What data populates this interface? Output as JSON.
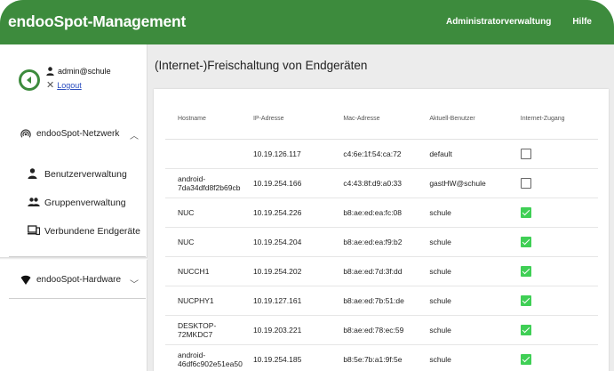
{
  "app": {
    "title": "endooSpot-Management",
    "nav": [
      "Administratorverwaltung",
      "Hilfe"
    ]
  },
  "user": {
    "name": "admin@schule",
    "logout": "Logout"
  },
  "sidebar": {
    "network_section": "endooSpot-Netzwerk",
    "items": [
      {
        "label": "Benutzerverwaltung",
        "icon": "person-icon"
      },
      {
        "label": "Gruppenverwaltung",
        "icon": "people-icon"
      },
      {
        "label": "Verbundene Endgeräte",
        "icon": "devices-icon"
      }
    ],
    "hardware_section": "endooSpot-Hardware"
  },
  "main": {
    "page_title": "(Internet-)Freischaltung von Endgeräten",
    "columns": [
      "Hostname",
      "IP-Adresse",
      "Mac-Adresse",
      "Aktuell-Benutzer",
      "Internet-Zugang"
    ],
    "rows": [
      {
        "host": "",
        "ip": "10.19.126.117",
        "mac": "c4:6e:1f:54:ca:72",
        "user": "default",
        "access": false
      },
      {
        "host": "android-7da34dfd8f2b69cb",
        "ip": "10.19.254.166",
        "mac": "c4:43:8f:d9:a0:33",
        "user": "gastHW@schule",
        "access": false
      },
      {
        "host": "NUC",
        "ip": "10.19.254.226",
        "mac": "b8:ae:ed:ea:fc:08",
        "user": "schule",
        "access": true
      },
      {
        "host": "NUC",
        "ip": "10.19.254.204",
        "mac": "b8:ae:ed:ea:f9:b2",
        "user": "schule",
        "access": true
      },
      {
        "host": "NUCCH1",
        "ip": "10.19.254.202",
        "mac": "b8:ae:ed:7d:3f:dd",
        "user": "schule",
        "access": true
      },
      {
        "host": "NUCPHY1",
        "ip": "10.19.127.161",
        "mac": "b8:ae:ed:7b:51:de",
        "user": "schule",
        "access": true
      },
      {
        "host": "DESKTOP-72MKDC7",
        "ip": "10.19.203.221",
        "mac": "b8:ae:ed:78:ec:59",
        "user": "schule",
        "access": true
      },
      {
        "host": "android-46df6c902e51ea50",
        "ip": "10.19.254.185",
        "mac": "b8:5e:7b:a1:9f:5e",
        "user": "schule",
        "access": true
      }
    ]
  },
  "colors": {
    "brand_green": "#3d8b3d",
    "check_green": "#3fcf55",
    "link_blue": "#2a4dbf"
  }
}
